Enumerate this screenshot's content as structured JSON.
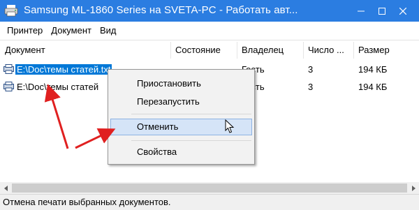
{
  "window": {
    "title": "Samsung ML-1860 Series на SVETA-PC  -  Работать авт...",
    "controls": {
      "minimize": "—",
      "maximize": "☐",
      "close": "✕"
    }
  },
  "menu": {
    "items": [
      {
        "label": "Принтер"
      },
      {
        "label": "Документ"
      },
      {
        "label": "Вид"
      }
    ]
  },
  "columns": {
    "document": "Документ",
    "status": "Состояние",
    "owner": "Владелец",
    "pages": "Число ...",
    "size": "Размер"
  },
  "rows": [
    {
      "document": "E:\\Doc\\темы статей.txt",
      "status": "",
      "owner": "Гость",
      "pages": "3",
      "size": "194 КБ",
      "selected": true
    },
    {
      "document": "E:\\Doc\\темы статей",
      "status": "",
      "owner": "Гость",
      "pages": "3",
      "size": "194 КБ",
      "selected": false
    }
  ],
  "context_menu": {
    "pause": "Приостановить",
    "restart": "Перезапустить",
    "cancel": "Отменить",
    "properties": "Свойства"
  },
  "statusbar": {
    "text": "Отмена печати выбранных документов."
  },
  "colors": {
    "titlebar": "#2b7de1",
    "selection": "#0078d7",
    "menu_hover": "#d5e4f7",
    "annotation_arrow": "#e02020"
  },
  "icons": {
    "title": "printer-icon",
    "row": "document-icon",
    "cursor": "mouse-pointer-icon"
  }
}
